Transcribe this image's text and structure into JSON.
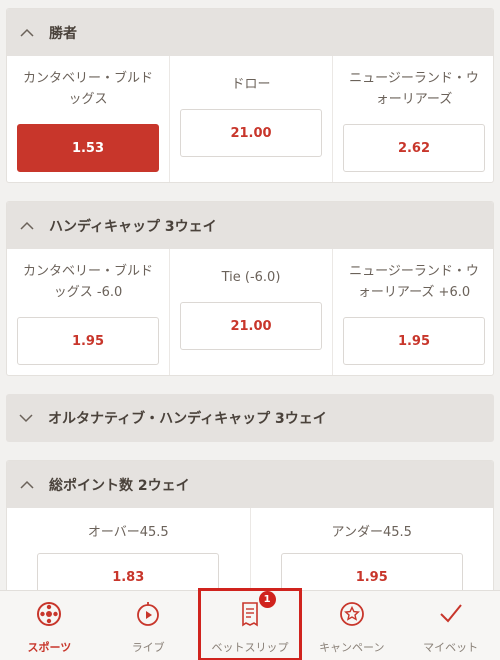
{
  "markets": [
    {
      "title": "勝者",
      "expanded": true,
      "selections": [
        {
          "name": "カンタベリー・ブルドッグス",
          "odds": "1.53",
          "selected": true
        },
        {
          "name": "ドロー",
          "odds": "21.00",
          "selected": false
        },
        {
          "name": "ニュージーランド・ウォーリアーズ",
          "odds": "2.62",
          "selected": false
        }
      ]
    },
    {
      "title": "ハンディキャップ 3ウェイ",
      "expanded": true,
      "selections": [
        {
          "name": "カンタベリー・ブルドッグス -6.0",
          "odds": "1.95"
        },
        {
          "name": "Tie (-6.0)",
          "odds": "21.00"
        },
        {
          "name": "ニュージーランド・ウォーリアーズ +6.0",
          "odds": "1.95"
        }
      ]
    },
    {
      "title": "オルタナティブ・ハンディキャップ 3ウェイ",
      "expanded": false
    },
    {
      "title": "総ポイント数 2ウェイ",
      "expanded": true,
      "selections": [
        {
          "name": "オーバー45.5",
          "odds": "1.83"
        },
        {
          "name": "アンダー45.5",
          "odds": "1.95"
        }
      ]
    }
  ],
  "nav": {
    "items": [
      {
        "label": "スポーツ",
        "icon": "sports-ball-icon",
        "active": true
      },
      {
        "label": "ライブ",
        "icon": "stopwatch-icon"
      },
      {
        "label": "ベットスリップ",
        "icon": "receipt-icon",
        "badge": "1"
      },
      {
        "label": "キャンペーン",
        "icon": "star-badge-icon"
      },
      {
        "label": "マイベット",
        "icon": "checkmark-icon"
      }
    ]
  },
  "colors": {
    "accent": "#c8362b",
    "header_bg": "#e5e2df",
    "highlight_border": "#d0231d"
  }
}
